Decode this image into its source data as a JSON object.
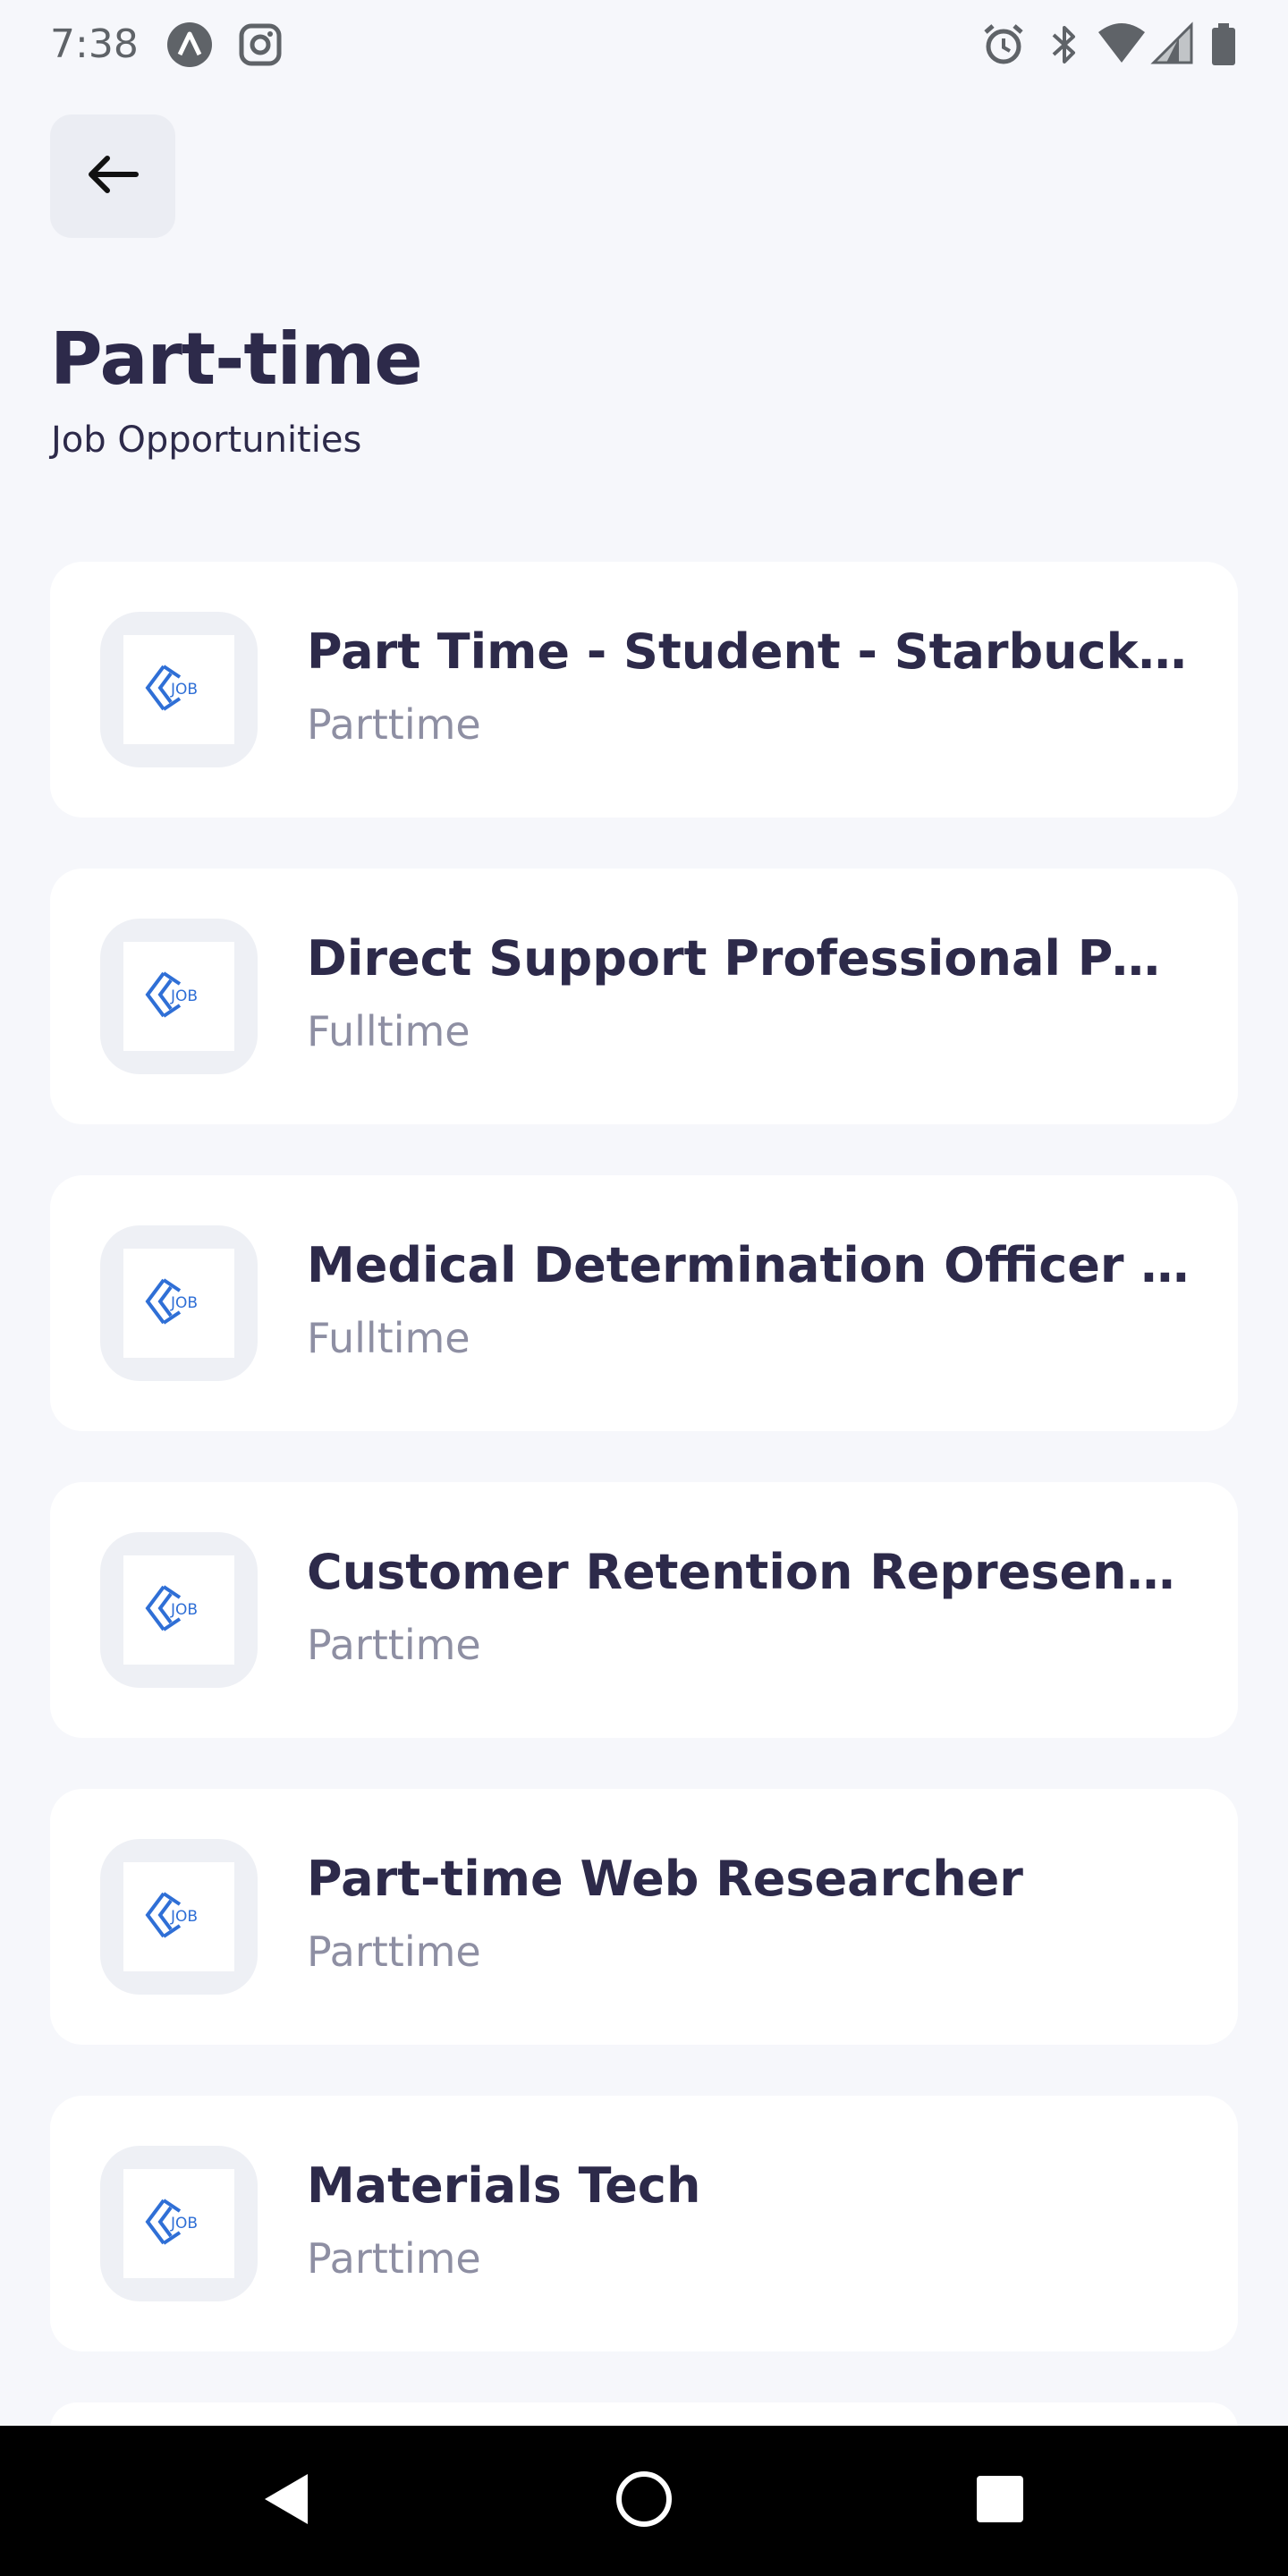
{
  "status_bar": {
    "time": "7:38",
    "left_icons": [
      "app-a-icon",
      "instagram-icon"
    ],
    "right_icons": [
      "alarm-icon",
      "bluetooth-icon",
      "wifi-icon",
      "signal-icon",
      "battery-icon"
    ]
  },
  "header": {
    "back_icon": "arrow-left-icon",
    "title": "Part-time",
    "subtitle": "Job Opportunities"
  },
  "jobs": [
    {
      "title": "Part Time - Student - Starbucks…",
      "type": "Parttime",
      "logo": "job-logo-icon"
    },
    {
      "title": "Direct Support Professional Part-…",
      "type": "Fulltime",
      "logo": "job-logo-icon"
    },
    {
      "title": "Medical Determination Officer (P…",
      "type": "Fulltime",
      "logo": "job-logo-icon"
    },
    {
      "title": "Customer Retention Representat…",
      "type": "Parttime",
      "logo": "job-logo-icon"
    },
    {
      "title": "Part-time Web Researcher",
      "type": "Parttime",
      "logo": "job-logo-icon"
    },
    {
      "title": "Materials Tech",
      "type": "Parttime",
      "logo": "job-logo-icon"
    }
  ],
  "nav_bar": {
    "icons": [
      "nav-back-icon",
      "nav-home-icon",
      "nav-recents-icon"
    ]
  },
  "colors": {
    "background": "#f6f7fb",
    "card": "#ffffff",
    "title_text": "#2d2a4a",
    "type_text": "#8e8fa3",
    "logo_blue": "#2f6fd6"
  }
}
